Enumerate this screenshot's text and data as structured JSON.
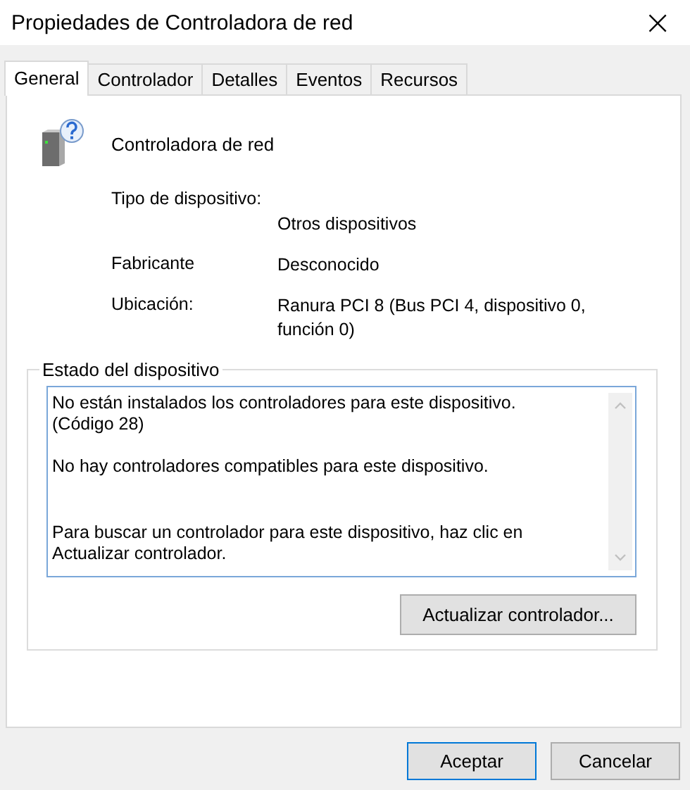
{
  "window": {
    "title": "Propiedades de Controladora de red",
    "close": "×"
  },
  "tabs": [
    {
      "label": "General",
      "selected": true
    },
    {
      "label": "Controlador",
      "selected": false
    },
    {
      "label": "Detalles",
      "selected": false
    },
    {
      "label": "Eventos",
      "selected": false
    },
    {
      "label": "Recursos",
      "selected": false
    }
  ],
  "device": {
    "name": "Controladora de red"
  },
  "properties": [
    {
      "label": "Tipo de dispositivo:",
      "value": "Otros dispositivos"
    },
    {
      "label": "Fabricante",
      "value": "Desconocido"
    },
    {
      "label": "Ubicación:",
      "value": "Ranura PCI 8 (Bus PCI 4, dispositivo 0, función 0)"
    }
  ],
  "status": {
    "title": "Estado del dispositivo",
    "paragraphs": [
      {
        "lines": [
          "No están instalados los controladores para este dispositivo.",
          "(Código 28)"
        ]
      },
      {
        "lines": [
          "No hay controladores compatibles para este dispositivo."
        ]
      },
      {
        "lines": [
          "Para buscar un controlador para este dispositivo, haz clic en",
          "Actualizar controlador."
        ]
      }
    ],
    "button": "Actualizar controlador..."
  },
  "buttons": [
    {
      "label": "Aceptar",
      "default": true
    },
    {
      "label": "Cancelar",
      "default": false
    }
  ]
}
